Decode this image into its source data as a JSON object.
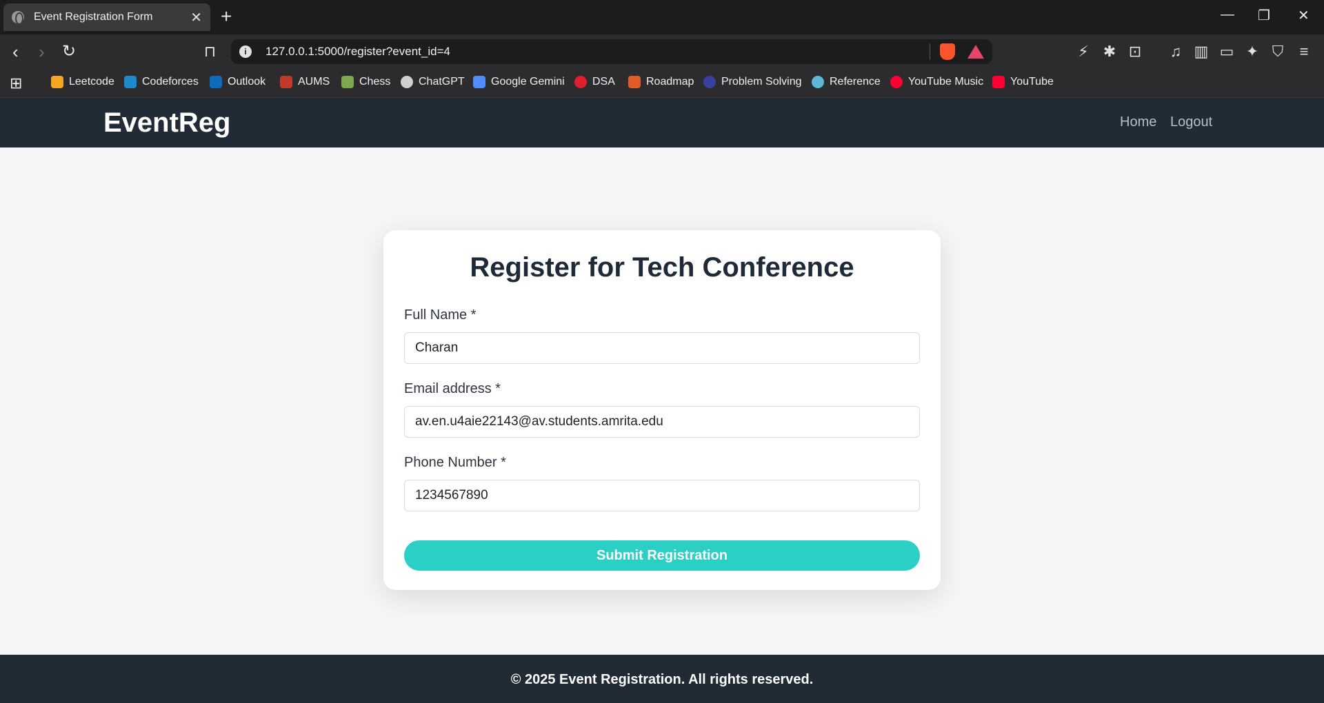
{
  "browser": {
    "tab_title": "Event Registration Form",
    "tab_close": "✕",
    "new_tab": "+",
    "url": "127.0.0.1:5000/register?event_id=4",
    "bookmarks": [
      {
        "label": "Leetcode",
        "color": "#f5a623"
      },
      {
        "label": "Codeforces",
        "color": "#1f8acb"
      },
      {
        "label": "Outlook",
        "color": "#0f6cbd"
      },
      {
        "label": "AUMS",
        "color": "#c0392b"
      },
      {
        "label": "Chess",
        "color": "#7fa650"
      },
      {
        "label": "ChatGPT",
        "color": "#d0d0d0"
      },
      {
        "label": "Google Gemini",
        "color": "#4f8df9"
      },
      {
        "label": "DSA",
        "color": "#e11d2e"
      },
      {
        "label": "Roadmap",
        "color": "#e05d2a"
      },
      {
        "label": "Problem Solving",
        "color": "#3b3f9e"
      },
      {
        "label": "Reference",
        "color": "#5bb8d9"
      },
      {
        "label": "YouTube Music",
        "color": "#ff0033"
      },
      {
        "label": "YouTube",
        "color": "#ff0033"
      }
    ]
  },
  "header": {
    "brand": "EventReg",
    "nav": [
      "Home",
      "Logout"
    ]
  },
  "form": {
    "title": "Register for Tech Conference",
    "fields": [
      {
        "label": "Full Name *",
        "value": "Charan"
      },
      {
        "label": "Email address *",
        "value": "av.en.u4aie22143@av.students.amrita.edu"
      },
      {
        "label": "Phone Number *",
        "value": "1234567890"
      }
    ],
    "submit_label": "Submit Registration"
  },
  "footer": {
    "text": "© 2025 Event Registration. All rights reserved."
  },
  "colors": {
    "accent": "#2ccfc6",
    "header_bg": "#212b36",
    "page_bg": "#f4f6f8"
  }
}
